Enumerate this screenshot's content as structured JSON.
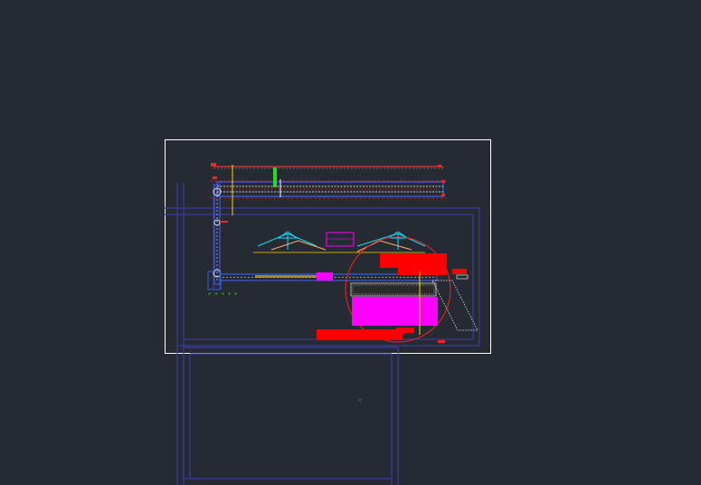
{
  "viewport": {
    "background": "#252a33"
  },
  "drawing": {
    "layer_colors": {
      "frame": "#ffffff",
      "walls": "#3a3aa0",
      "conveyor": "#3b5bd8",
      "annotation": "#ff2020",
      "hatch": "#ffffff",
      "magenta_block": "#ff00ff",
      "red_block": "#ff0000",
      "cyan_truss": "#00e5ff",
      "yellow": "#ffd200",
      "green": "#22dd22",
      "truss_orange": "#ffb060"
    },
    "icons": [
      "cad-model-space"
    ]
  }
}
